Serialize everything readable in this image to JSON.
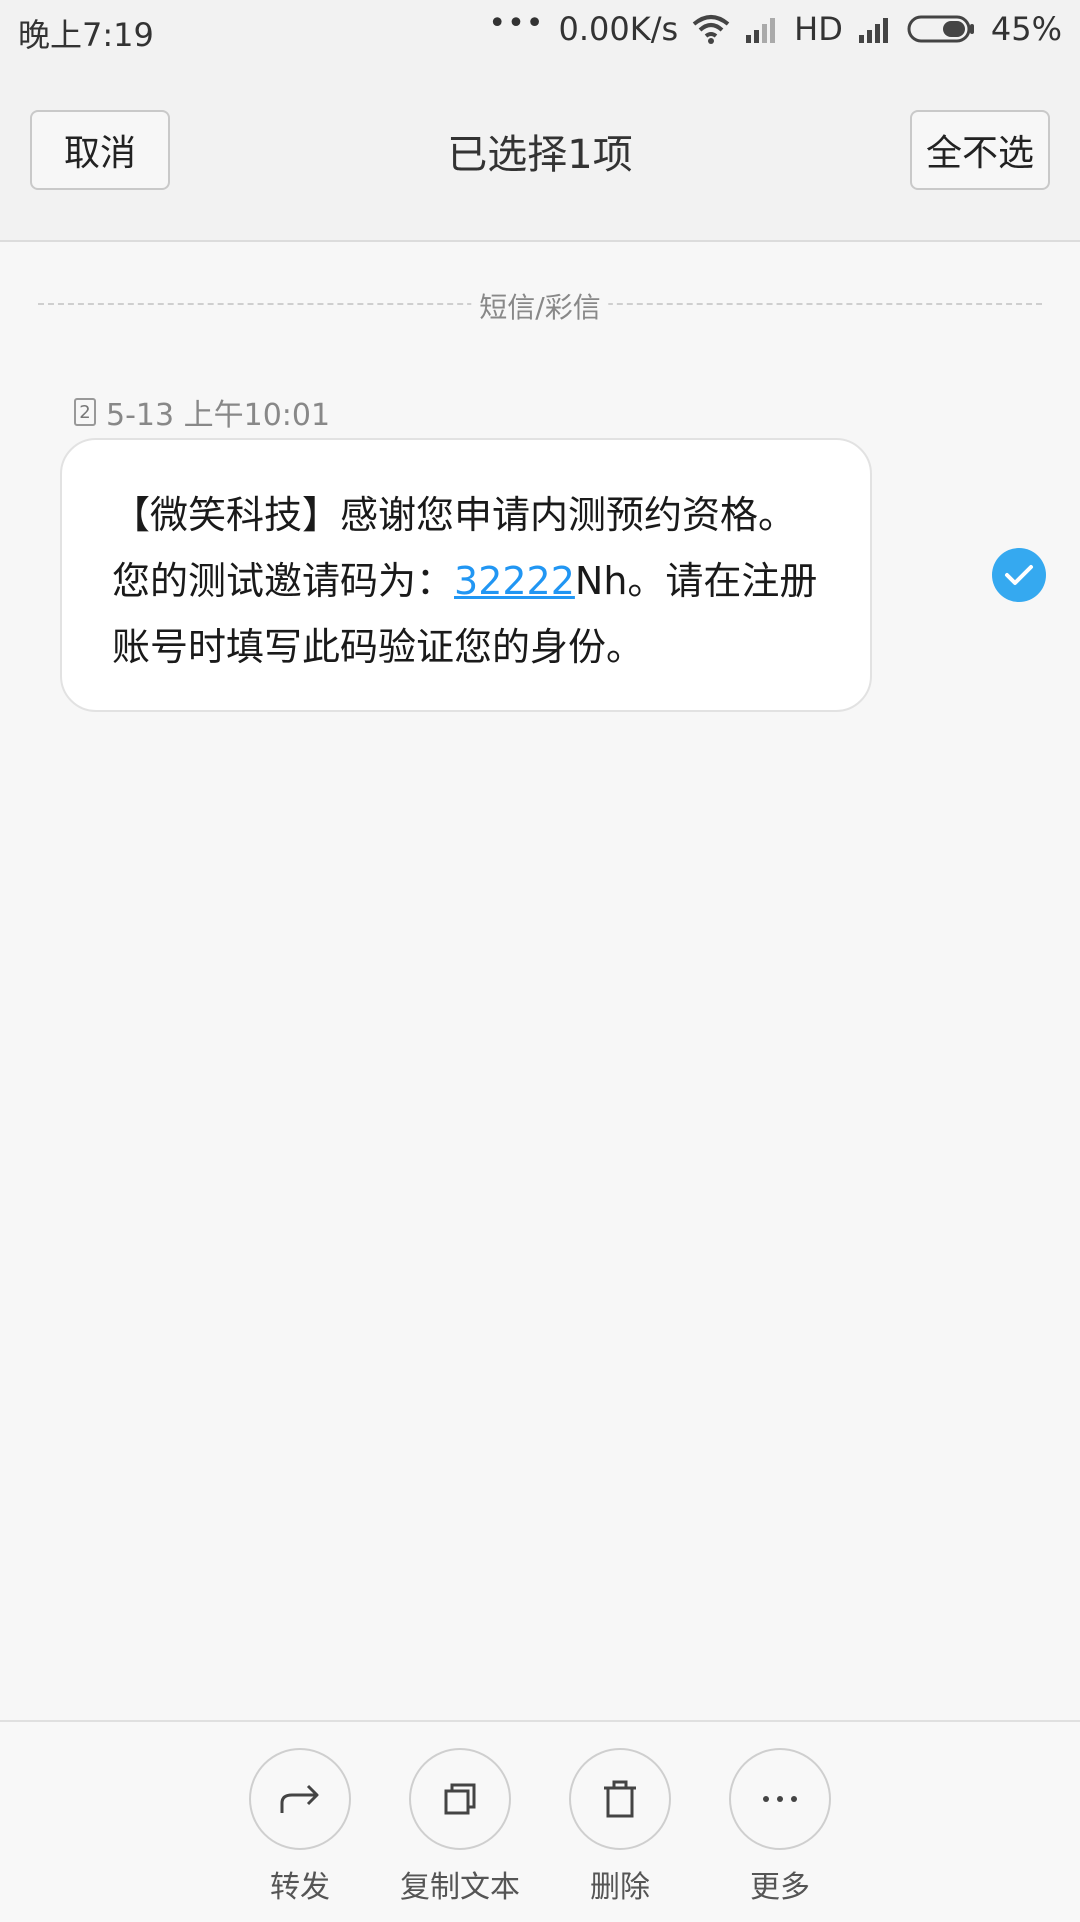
{
  "status_bar": {
    "time": "晚上7:19",
    "dots": "•••",
    "net_speed": "0.00K/s",
    "hd": "HD",
    "battery": "45%"
  },
  "header": {
    "cancel_label": "取消",
    "title": "已选择1项",
    "deselect_label": "全不选"
  },
  "section": {
    "label": "短信/彩信"
  },
  "message": {
    "sim": "2",
    "timestamp": "5-13 上午10:01",
    "text_before": "【微笑科技】感谢您申请内测预约资格。您的测试邀请码为：",
    "code": "32222",
    "text_after": "Nh。请在注册账号时填写此码验证您的身份。",
    "selected": true
  },
  "toolbar": {
    "items": [
      {
        "label": "转发",
        "icon": "forward-icon"
      },
      {
        "label": "复制文本",
        "icon": "copy-icon"
      },
      {
        "label": "删除",
        "icon": "trash-icon"
      },
      {
        "label": "更多",
        "icon": "more-icon"
      }
    ]
  },
  "colors": {
    "accent": "#35a9f0",
    "link": "#2196f3"
  }
}
